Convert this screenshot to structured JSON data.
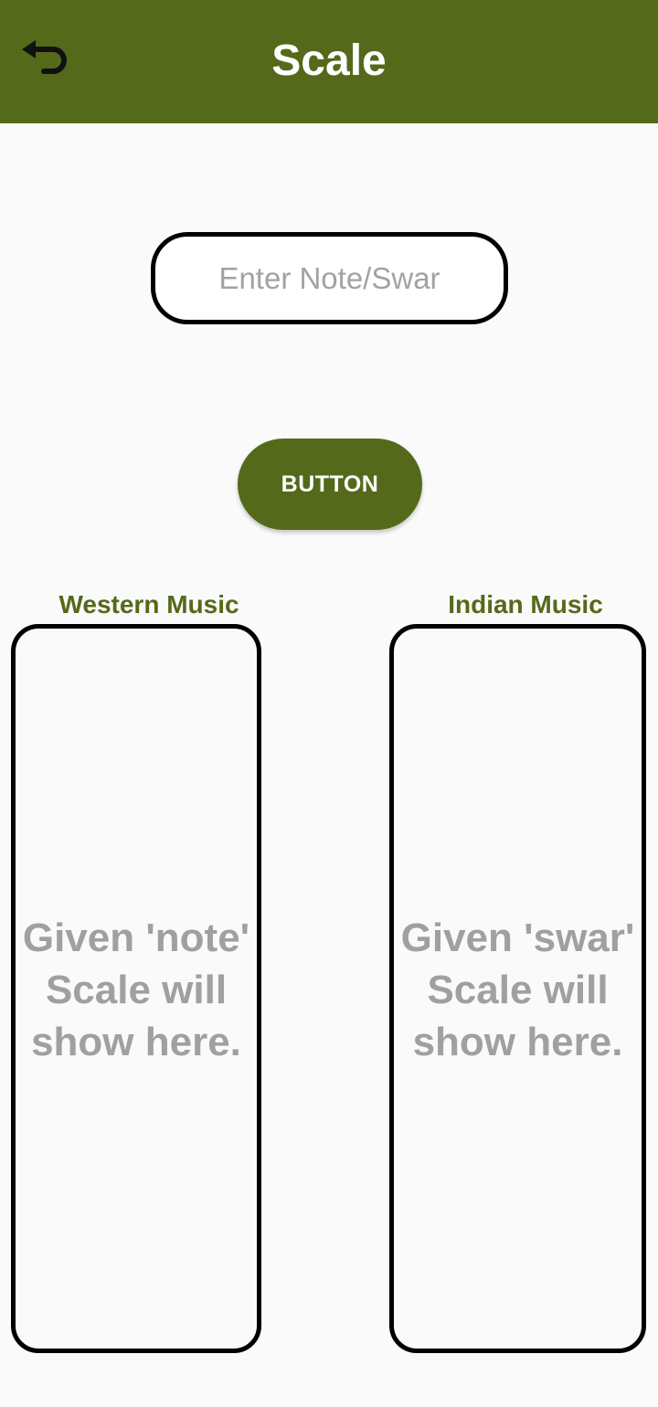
{
  "app_bar": {
    "title": "Scale",
    "back_icon": "undo-arrow-icon",
    "background_color": "#55691b"
  },
  "input": {
    "placeholder": "Enter Note/Swar",
    "value": ""
  },
  "action_button": {
    "label": "BUTTON"
  },
  "western": {
    "label": "Western Music",
    "placeholder_text": "Given 'note'\nScale will\nshow here."
  },
  "indian": {
    "label": "Indian Music",
    "placeholder_text": "Given 'swar'\nScale will\nshow here."
  },
  "colors": {
    "accent": "#55691b",
    "placeholder_gray": "#a0a0a0",
    "page_background": "#fafafa"
  }
}
